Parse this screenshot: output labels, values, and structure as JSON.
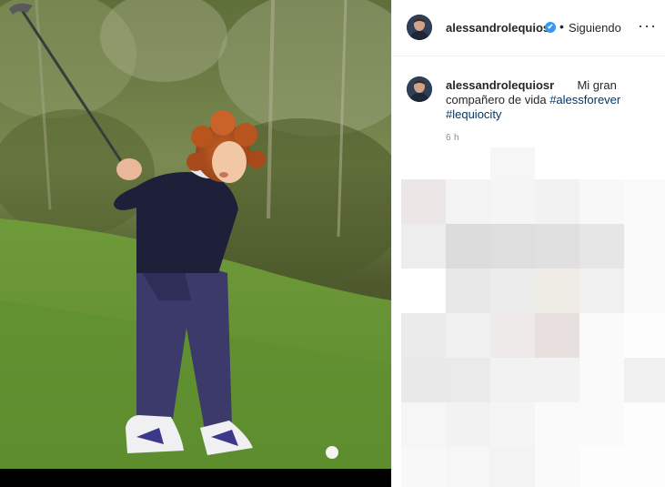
{
  "post": {
    "username": "alessandrolequiosr",
    "follow_status": "Siguiendo",
    "bullet": "•",
    "more_icon": "···",
    "verified_icon": "✔",
    "caption": {
      "text": "Mi gran compañero de vida",
      "hashtags": [
        "#alessforever",
        "#lequiocity"
      ]
    },
    "time_ago": "6 h"
  },
  "colors": {
    "username": "#262626",
    "hashtag": "#00376b",
    "verified": "#3897f0",
    "muted": "#8e8e8e"
  },
  "icons": {
    "verified": "verified-badge-icon",
    "more": "more-options-icon"
  }
}
